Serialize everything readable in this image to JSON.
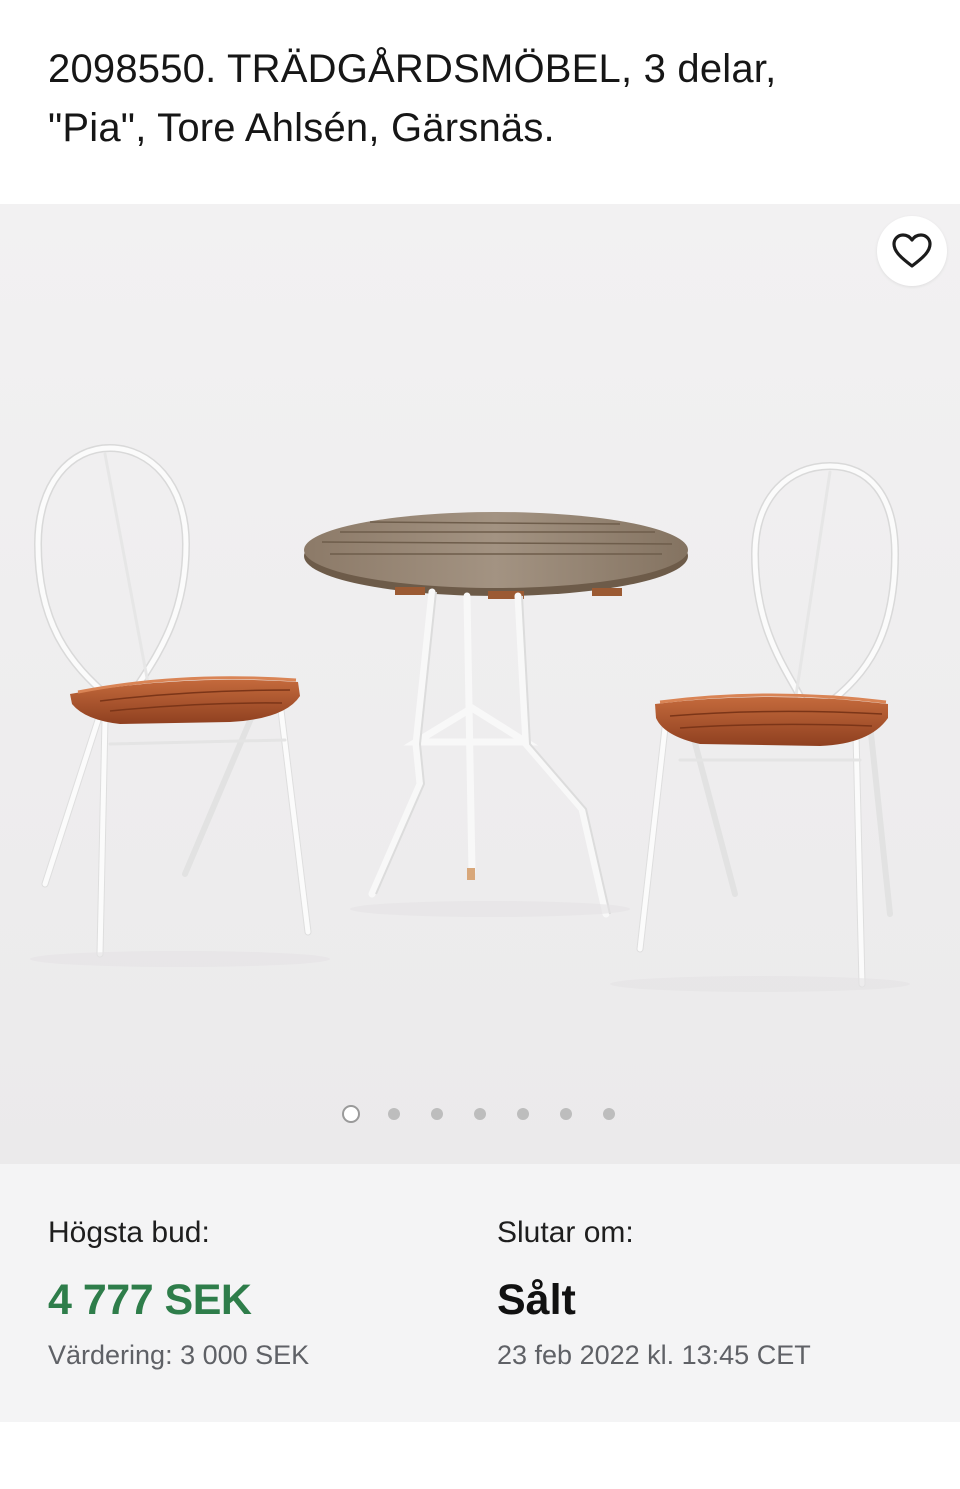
{
  "listing": {
    "title": "2098550. TRÄDGÅRDSMÖBEL, 3 delar, \"Pia\", Tore Ahlsén, Gärsnäs."
  },
  "gallery": {
    "image_alt": "Trädgårdsmöbel, två stolar och ett runt bord",
    "favorite_icon": "heart-outline-icon",
    "dot_count": 7,
    "active_dot": 1
  },
  "bid": {
    "label": "Högsta bud:",
    "amount": "4 777 SEK",
    "valuation": "Värdering: 3 000 SEK"
  },
  "ending": {
    "label": "Slutar om:",
    "status": "Sålt",
    "date": "23 feb 2022 kl. 13:45 CET"
  },
  "colors": {
    "accent_green": "#2e7d4a",
    "gallery_bg": "#f1f0f1",
    "info_bg": "#f4f4f5"
  }
}
